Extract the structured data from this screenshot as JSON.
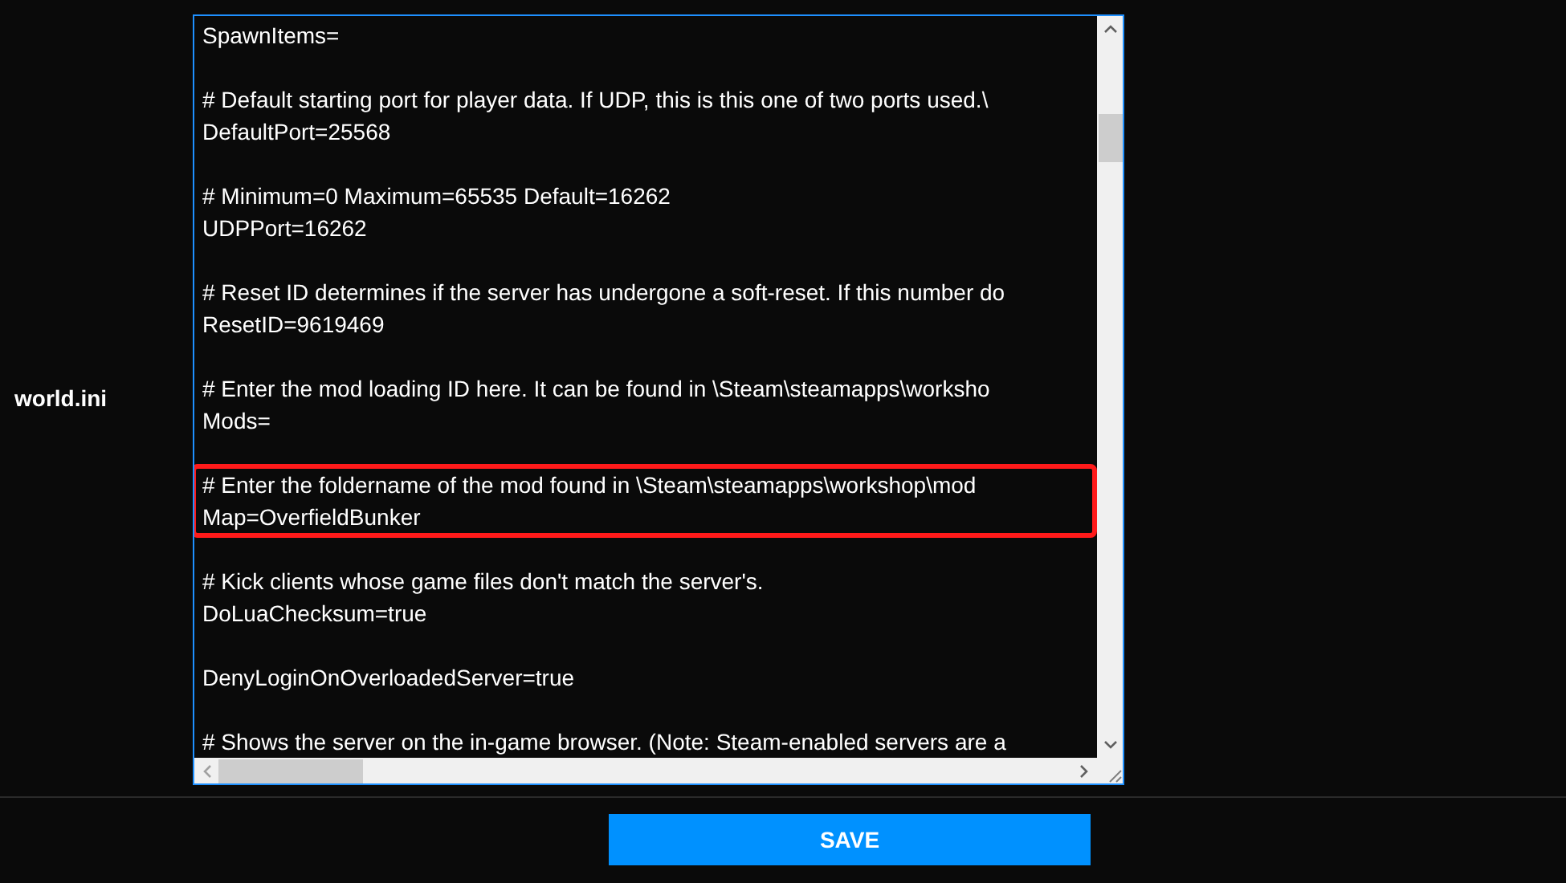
{
  "setting": {
    "label": "world.ini"
  },
  "editor": {
    "blocks": [
      {
        "highlighted": false,
        "lines": [
          "SpawnItems="
        ]
      },
      {
        "highlighted": false,
        "lines": [
          "# Default starting port for player data. If UDP, this is this one of two ports used.\\",
          "DefaultPort=25568"
        ]
      },
      {
        "highlighted": false,
        "lines": [
          "# Minimum=0 Maximum=65535 Default=16262",
          "UDPPort=16262"
        ]
      },
      {
        "highlighted": false,
        "lines": [
          "# Reset ID determines if the server has undergone a soft-reset. If this number do",
          "ResetID=9619469"
        ]
      },
      {
        "highlighted": false,
        "lines": [
          "# Enter the mod loading ID here. It can be found in \\Steam\\steamapps\\worksho",
          "Mods="
        ]
      },
      {
        "highlighted": true,
        "lines": [
          "# Enter the foldername of the mod found in \\Steam\\steamapps\\workshop\\mod",
          "Map=OverfieldBunker"
        ]
      },
      {
        "highlighted": false,
        "lines": [
          "# Kick clients whose game files don't match the server's.",
          "DoLuaChecksum=true"
        ]
      },
      {
        "highlighted": false,
        "lines": [
          "DenyLoginOnOverloadedServer=true"
        ]
      },
      {
        "highlighted": false,
        "lines": [
          "# Shows the server on the in-game browser. (Note: Steam-enabled servers are a"
        ]
      }
    ]
  },
  "save_button": {
    "label": "SAVE"
  }
}
